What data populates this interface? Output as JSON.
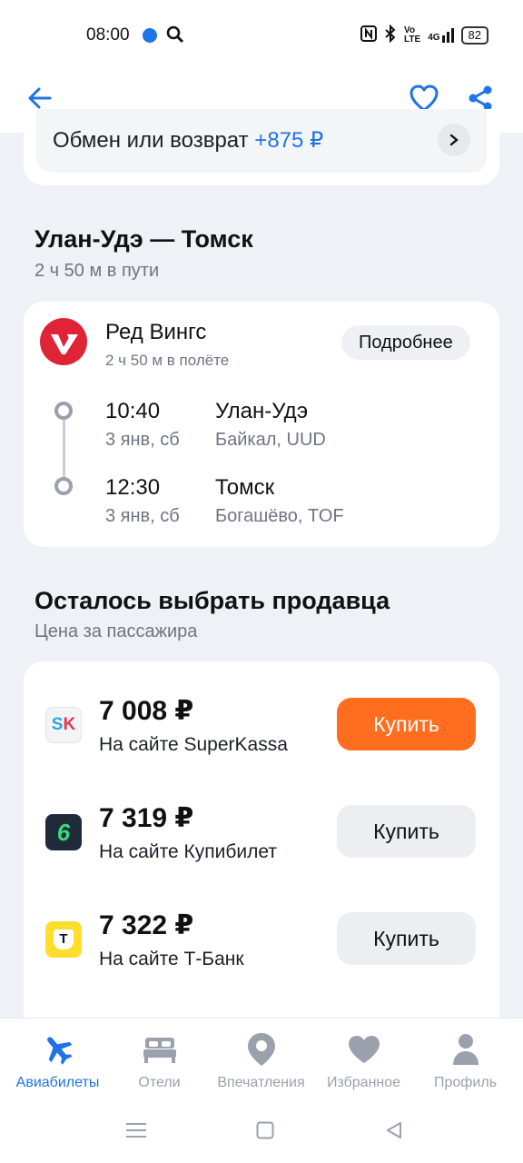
{
  "status": {
    "time": "08:00",
    "battery": "82",
    "signal_text": "4G"
  },
  "exchange": {
    "label": "Обмен или возврат",
    "price": "+875 ₽"
  },
  "route": {
    "title": "Улан-Удэ — Томск",
    "duration": "2 ч 50 м в пути"
  },
  "flight": {
    "airline": "Ред Вингс",
    "airtime": "2 ч 50 м в полёте",
    "details_label": "Подробнее",
    "departure": {
      "time": "10:40",
      "date": "3 янв, сб",
      "city": "Улан-Удэ",
      "airport": "Байкал, UUD"
    },
    "arrival": {
      "time": "12:30",
      "date": "3 янв, сб",
      "city": "Томск",
      "airport": "Богашёво, TOF"
    }
  },
  "sellers_section": {
    "title": "Осталось выбрать продавца",
    "subtitle": "Цена за пассажира"
  },
  "sellers": [
    {
      "price": "7 008 ₽",
      "site": "На сайте SuperKassa",
      "buy_label": "Купить",
      "logo_text": "SK",
      "primary": true
    },
    {
      "price": "7 319 ₽",
      "site": "На сайте Купибилет",
      "buy_label": "Купить",
      "logo_text": "6",
      "primary": false
    },
    {
      "price": "7 322 ₽",
      "site": "На сайте Т-Банк",
      "buy_label": "Купить",
      "logo_text": "Т",
      "primary": false
    }
  ],
  "bottom_nav": [
    {
      "label": "Авиабилеты",
      "icon": "plane-icon",
      "active": true
    },
    {
      "label": "Отели",
      "icon": "bed-icon",
      "active": false
    },
    {
      "label": "Впечатления",
      "icon": "pin-icon",
      "active": false
    },
    {
      "label": "Избранное",
      "icon": "heart-icon",
      "active": false
    },
    {
      "label": "Профиль",
      "icon": "profile-icon",
      "active": false
    }
  ],
  "colors": {
    "accent": "#1e73e6",
    "buy_primary": "#ff6d1f",
    "airline": "#e02438"
  }
}
